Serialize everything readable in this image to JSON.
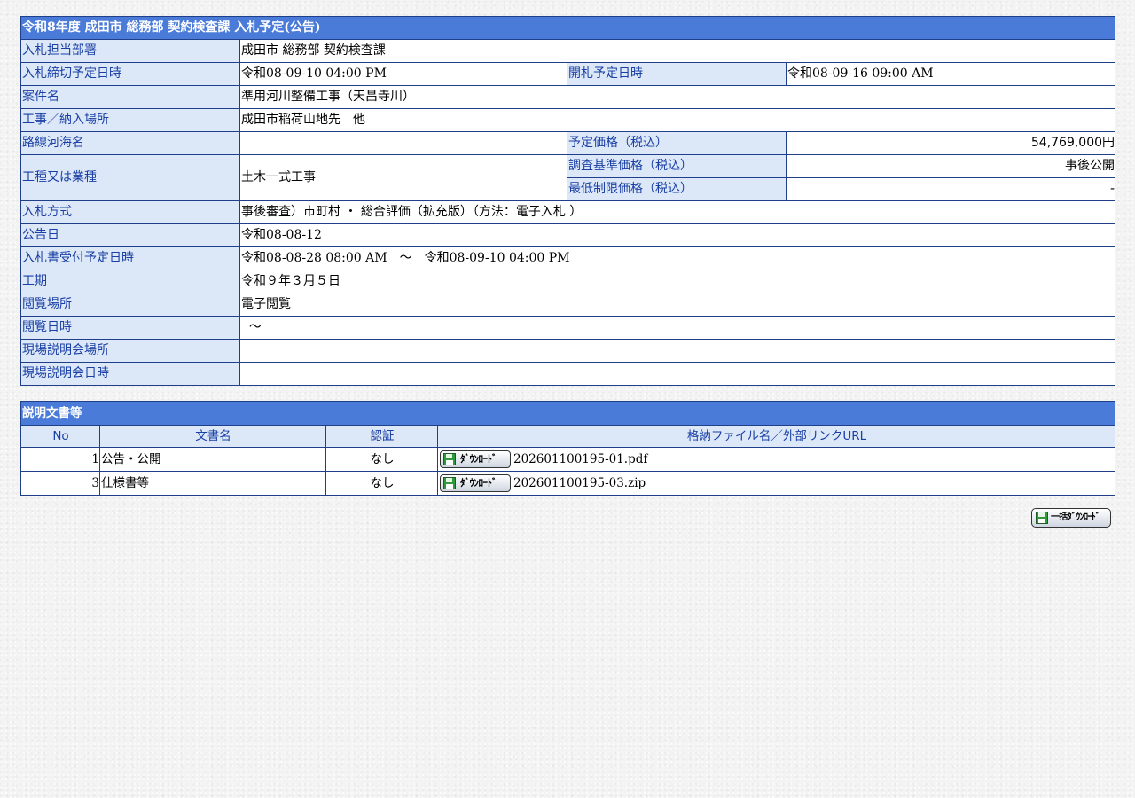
{
  "main": {
    "title": "令和8年度  成田市  総務部  契約検査課  入札予定(公告)",
    "rows": {
      "department": {
        "label": "入札担当部署",
        "value": "成田市  総務部  契約検査課"
      },
      "deadline": {
        "label": "入札締切予定日時",
        "value": "令和08-09-10 04:00 PM",
        "label2": "開札予定日時",
        "value2": "令和08-09-16 09:00 AM"
      },
      "project_name": {
        "label": "案件名",
        "value": "準用河川整備工事（天昌寺川）"
      },
      "location": {
        "label": "工事／納入場所",
        "value": "成田市稲荷山地先　他"
      },
      "route": {
        "label": "路線河海名",
        "value": "",
        "label2": "予定価格（税込）",
        "value2": "54,769,000円"
      },
      "category": {
        "label": "工種又は業種",
        "value": "土木一式工事",
        "label2": "調査基準価格（税込）",
        "value2": "事後公開",
        "label3": "最低制限価格（税込）",
        "value3": "-"
      },
      "method": {
        "label": "入札方式",
        "value": "事後審査）市町村 ・ 総合評価（拡充版）（方法：電子入札 ）"
      },
      "announce_date": {
        "label": "公告日",
        "value": "令和08-08-12"
      },
      "accept_period": {
        "label": "入札書受付予定日時",
        "value": "令和08-08-28 08:00 AM　～　令和08-09-10 04:00 PM"
      },
      "term": {
        "label": "工期",
        "value": "令和９年３月５日"
      },
      "view_place": {
        "label": "閲覧場所",
        "value": "電子閲覧"
      },
      "view_date": {
        "label": "閲覧日時",
        "value": "  ～"
      },
      "site_place": {
        "label": "現場説明会場所",
        "value": ""
      },
      "site_date": {
        "label": "現場説明会日時",
        "value": ""
      }
    }
  },
  "docs": {
    "title": "説明文書等",
    "headers": {
      "no": "No",
      "name": "文書名",
      "auth": "認証",
      "file": "格納ファイル名／外部リンクURL"
    },
    "items": [
      {
        "no": "1",
        "name": "公告・公開",
        "auth": "なし",
        "file": "202601100195-01.pdf"
      },
      {
        "no": "3",
        "name": "仕様書等",
        "auth": "なし",
        "file": "202601100195-03.zip"
      }
    ],
    "download_label": "ﾀﾞｳﾝﾛｰﾄﾞ",
    "download_icon": "floppy-disk-icon"
  },
  "bulk": {
    "label": "一括ﾀﾞｳﾝﾛｰﾄﾞ",
    "icon": "floppy-disk-icon"
  },
  "colors": {
    "header_bg": "#4a7bd8",
    "label_bg": "#dce8f7",
    "label_text": "#1a3fa6",
    "border": "#1f3f8a"
  }
}
